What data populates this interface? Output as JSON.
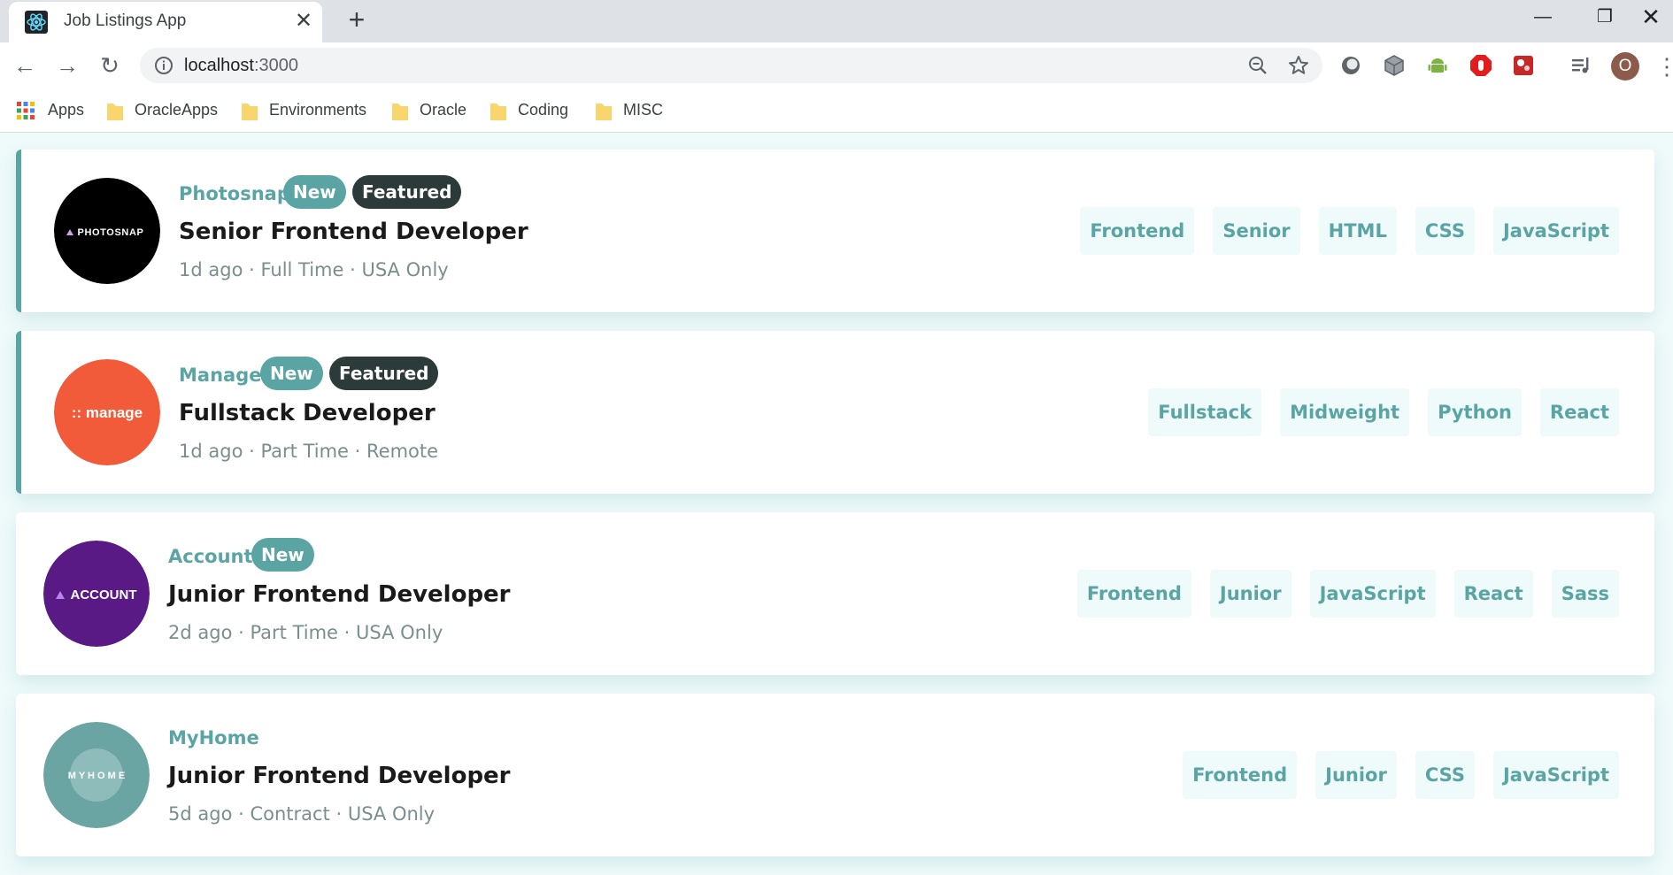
{
  "browser": {
    "tab_title": "Job Listings App",
    "url_host": "localhost",
    "url_port": ":3000",
    "profile_initial": "O",
    "bookmarks": [
      "Apps",
      "OracleApps",
      "Environments",
      "Oracle",
      "Coding",
      "MISC"
    ]
  },
  "colors": {
    "accent": "#5ba4a4",
    "featured_badge": "#2c3a3a",
    "tag_bg": "#effafa",
    "page_bg": "#effafa"
  },
  "jobs": [
    {
      "company": "Photosnap",
      "logo_text": "PHOTOSNAP",
      "new": "New",
      "featured": "Featured",
      "position": "Senior Frontend Developer",
      "posted": "1d ago",
      "contract": "Full Time",
      "location": "USA Only",
      "tags": [
        "Frontend",
        "Senior",
        "HTML",
        "CSS",
        "JavaScript"
      ]
    },
    {
      "company": "Manage",
      "logo_text": ":: manage",
      "new": "New",
      "featured": "Featured",
      "position": "Fullstack Developer",
      "posted": "1d ago",
      "contract": "Part Time",
      "location": "Remote",
      "tags": [
        "Fullstack",
        "Midweight",
        "Python",
        "React"
      ]
    },
    {
      "company": "Account",
      "logo_text": "ACCOUNT",
      "new": "New",
      "position": "Junior Frontend Developer",
      "posted": "2d ago",
      "contract": "Part Time",
      "location": "USA Only",
      "tags": [
        "Frontend",
        "Junior",
        "JavaScript",
        "React",
        "Sass"
      ]
    },
    {
      "company": "MyHome",
      "logo_text": "M Y H O M E",
      "position": "Junior Frontend Developer",
      "posted": "5d ago",
      "contract": "Contract",
      "location": "USA Only",
      "tags": [
        "Frontend",
        "Junior",
        "CSS",
        "JavaScript"
      ]
    }
  ]
}
